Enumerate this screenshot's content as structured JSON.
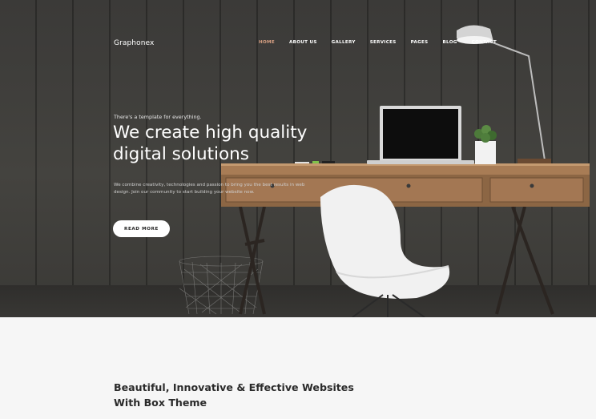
{
  "header": {
    "brand": "Graphonex",
    "nav": [
      {
        "label": "HOME",
        "active": true
      },
      {
        "label": "ABOUT US",
        "active": false
      },
      {
        "label": "GALLERY",
        "active": false
      },
      {
        "label": "SERVICES",
        "active": false
      },
      {
        "label": "PAGES",
        "active": false
      },
      {
        "label": "BLOG",
        "active": false
      },
      {
        "label": "CONTACT",
        "active": false
      }
    ]
  },
  "hero": {
    "eyebrow": "There's a template for everything.",
    "headline": "We create high quality digital solutions",
    "description": "We combine creativity, technologies and passion to bring you the best results in web design. Join our community to start building your website now.",
    "cta_label": "READ MORE"
  },
  "section": {
    "title": "Beautiful, Innovative & Effective Websites With Box Theme"
  },
  "colors": {
    "accent": "#d8a083",
    "hero_bg": "#3f3e3b",
    "page_bg": "#f6f6f6"
  }
}
